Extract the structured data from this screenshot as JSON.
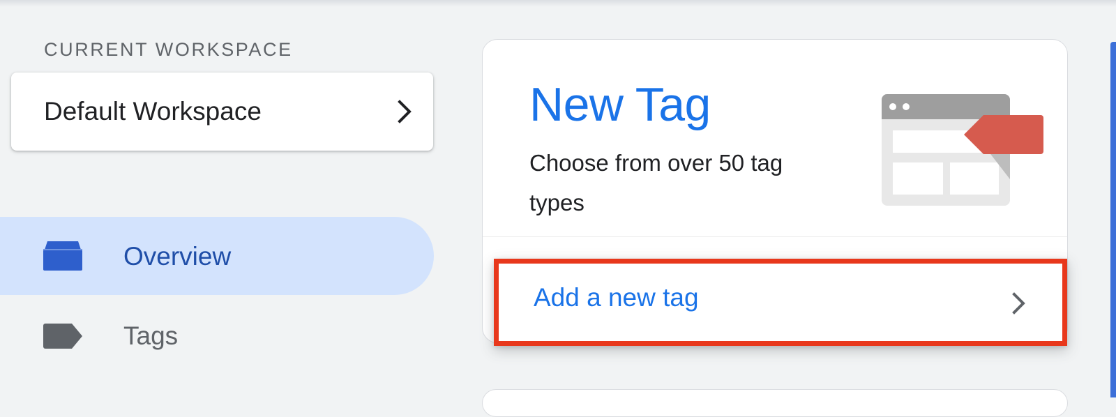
{
  "workspace": {
    "caption": "CURRENT WORKSPACE",
    "name": "Default Workspace",
    "chevron_icon": "chevron-right-icon"
  },
  "nav": {
    "items": [
      {
        "label": "Overview",
        "icon": "overview-icon",
        "active": true
      },
      {
        "label": "Tags",
        "icon": "tag-icon",
        "active": false
      }
    ]
  },
  "new_tag_card": {
    "title": "New Tag",
    "description": "Choose from over 50 tag types",
    "illustration": "tag-browser-illustration",
    "action_label": "Add a new tag",
    "action_icon": "chevron-right-icon"
  },
  "colors": {
    "accent": "#1a73e8",
    "nav_active_bg": "#d3e3fd",
    "nav_active_text": "#1f4ea8",
    "nav_inactive": "#5f6368",
    "highlight_border": "#e8381c",
    "tag_red": "#d65b4e"
  }
}
